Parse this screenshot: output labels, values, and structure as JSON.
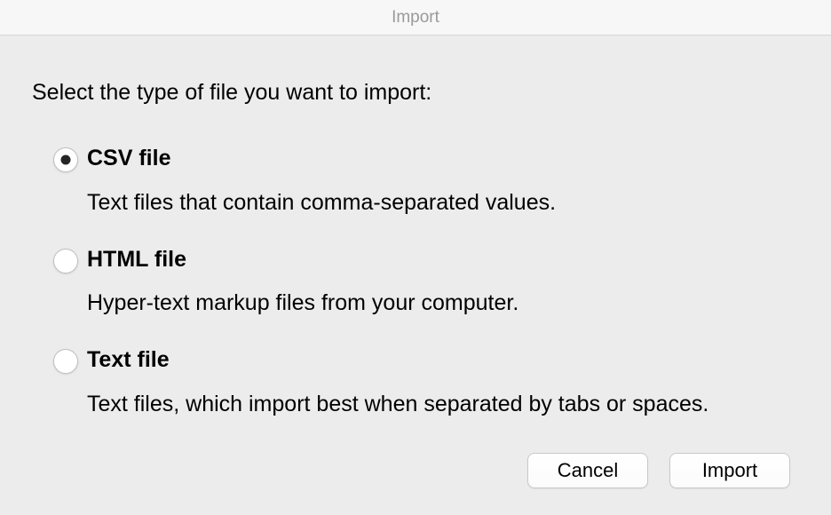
{
  "window": {
    "title": "Import"
  },
  "prompt": "Select the type of file you want to import:",
  "options": [
    {
      "label": "CSV file",
      "description": "Text files that contain comma-separated values.",
      "selected": true
    },
    {
      "label": "HTML file",
      "description": "Hyper-text markup files from your computer.",
      "selected": false
    },
    {
      "label": "Text file",
      "description": "Text files, which import best when separated by tabs or spaces.",
      "selected": false
    }
  ],
  "buttons": {
    "cancel": "Cancel",
    "import": "Import"
  }
}
